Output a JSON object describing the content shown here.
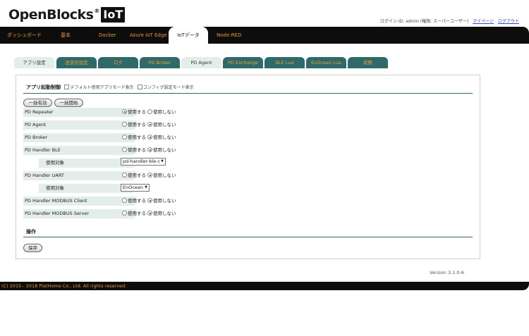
{
  "logo": {
    "text": "OpenBlocks",
    "reg": "®",
    "iot": "IoT"
  },
  "userbar": {
    "login": "ログイン ID: admin (権限: スーパーユーザー)",
    "mypage": "マイページ",
    "logout": "ログアウト"
  },
  "mainnav": {
    "items": [
      "ダッシュボード",
      "基本",
      "Docker",
      "Azure IoT Edge",
      "IoTデータ",
      "Node-RED"
    ],
    "active": "IoTデータ"
  },
  "subtabs": {
    "items": [
      "アプリ設定",
      "送受信設定",
      "ログ",
      "PD Broker",
      "PD Agent",
      "PD Exchange",
      "BLE Lua",
      "EnOcean Lua",
      "状態"
    ],
    "active": "アプリ設定"
  },
  "app_control": {
    "title": "アプリ起動制御",
    "option_default": "デフォルト使用アプリモード表示",
    "option_config": "コンフィグ設定モード表示",
    "btn_disable_all": "一括有効",
    "btn_enable_all": "一括開始",
    "use_label": "使用する",
    "nouse_label": "使用しない",
    "target_label": "使用対象",
    "rows": [
      {
        "name": "PD Repeater",
        "use": true
      },
      {
        "name": "PD Agent",
        "use": false
      },
      {
        "name": "PD Broker",
        "use": false
      },
      {
        "name": "PD Handler BLE",
        "use": false
      },
      {
        "name": "PD Handler UART",
        "use": false
      },
      {
        "name": "PD Handler MODBUS Client",
        "use": false
      },
      {
        "name": "PD Handler MODBUS Server",
        "use": false
      }
    ],
    "ble_target": "pd-handler-ble-c",
    "uart_target": "EnOcean"
  },
  "operation": {
    "title": "操作",
    "save": "保存"
  },
  "version": "Version 3.1.0-6",
  "footer": "(C) 2015 - 2018 PlatHome Co., Ltd. All rights reserved.",
  "colors": {
    "nav_bg": "#0d0d0d",
    "nav_text": "#e89a2b",
    "tab_dark": "#2f6a6a",
    "tab_light": "#e3ede9"
  }
}
